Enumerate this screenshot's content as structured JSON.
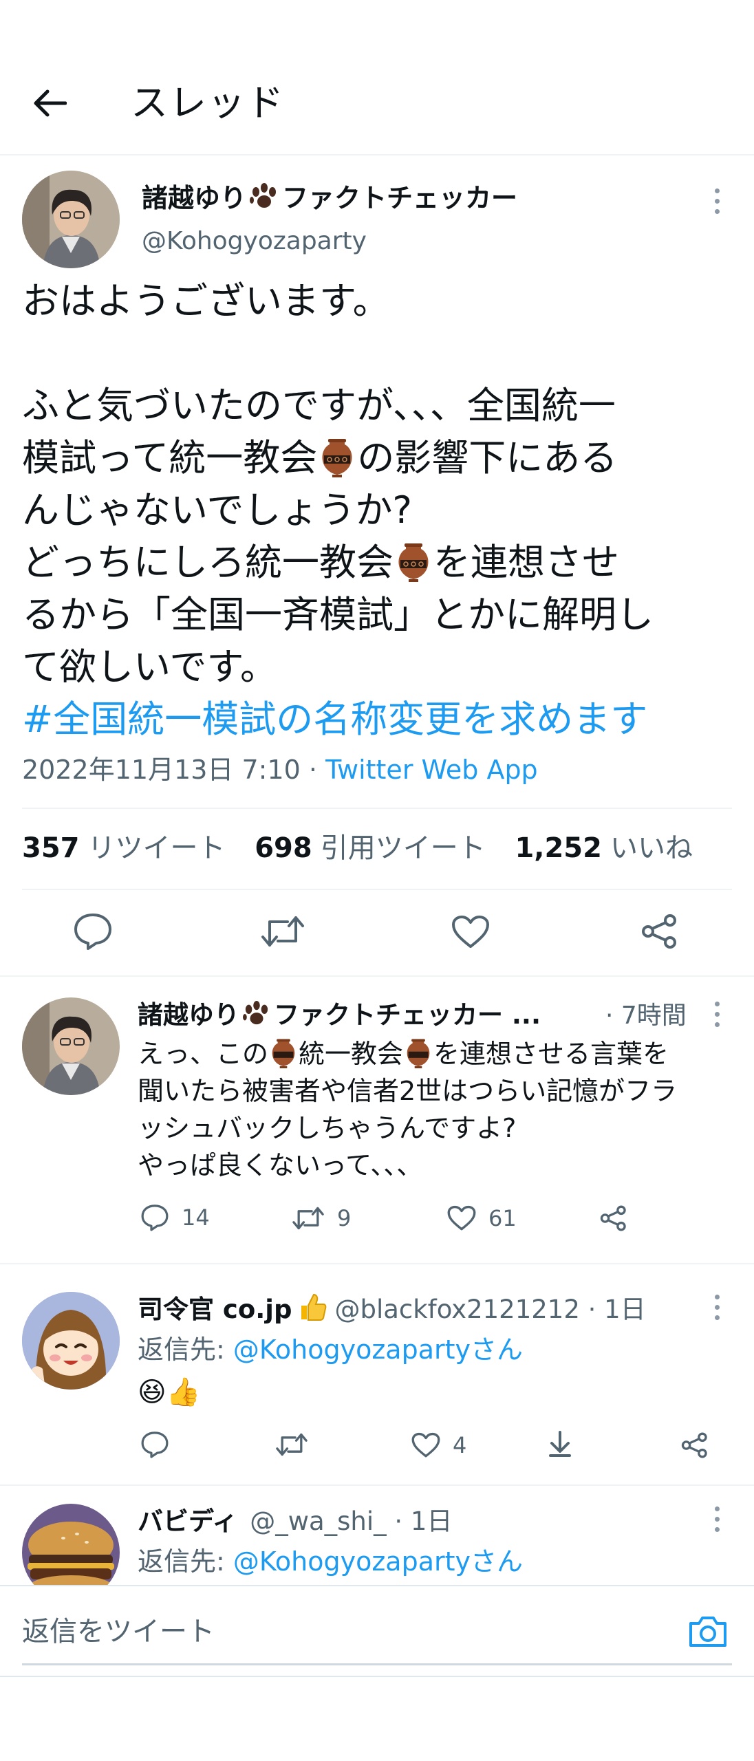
{
  "header": {
    "title": "スレッド"
  },
  "main_tweet": {
    "author_name": "諸越ゆり",
    "author_suffix": "ファクトチェッカー",
    "handle": "@Kohogyozaparty",
    "line1": "おはようございます。",
    "line2": "ふと気づいたのですが、、、全国統一",
    "line3a": "模試って統一教会",
    "line3b": "の影響下にある",
    "line4": "んじゃないでしょうか?",
    "line5a": "どっちにしろ統一教会",
    "line5b": "を連想させ",
    "line6": "るから「全国一斉模試」とかに解明し",
    "line7": "て欲しいです。",
    "hashtag": "#全国統一模試の名称変更を求めます",
    "timestamp": "2022年11月13日 7:10 · ",
    "client": "Twitter Web App",
    "retweets_count": "357",
    "retweets_label": "リツイート",
    "quotes_count": "698",
    "quotes_label": "引用ツイート",
    "likes_count": "1,252",
    "likes_label": "いいね"
  },
  "replies": [
    {
      "author_name": "諸越ゆり",
      "author_suffix": "ファクトチェッカー ...",
      "time": "· 7時間",
      "line1a": "えっ、この",
      "line1b": "統一教会",
      "line1c": "を連想させる言葉を",
      "line2": "聞いたら被害者や信者2世はつらい記憶がフラ",
      "line3": "ッシュバックしちゃうんですよ?",
      "line4": "やっぱ良くないって、、、",
      "reply_count": "14",
      "retweet_count": "9",
      "like_count": "61"
    },
    {
      "author_name": "司令官 co.jp",
      "handle": "@blackfox2121212 · 1日",
      "reply_to_label": "返信先: ",
      "reply_to_handle": "@Kohogyozapartyさん",
      "body_emoji": "😆👍",
      "like_count": "4"
    },
    {
      "author_name": "バビディ",
      "handle": "@_wa_shi_ · 1日",
      "reply_to_label": "返信先: ",
      "reply_to_handle": "@Kohogyozapartyさん"
    }
  ],
  "composer": {
    "placeholder": "返信をツイート"
  },
  "colors": {
    "link": "#1d9bf0",
    "secondary": "#536471",
    "divider": "#eff3f4"
  }
}
